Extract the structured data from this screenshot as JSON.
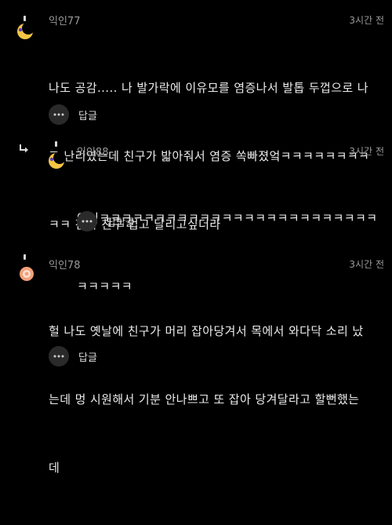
{
  "comments": [
    {
      "nickname": "익인77",
      "time": "3시간 전",
      "lines": [
        "나도 공감..... 나 발가락에 이유모를 염증나서 발톱 두껍으로 나",
        "고 난리였는데 친구가 밟아줘서 염증 쏙빠졌엌ㅋㅋㅋㅋㅋㅋㅋㅋ",
        "ㅋㅋ 진짜 친구 업고 달리고싶더라"
      ],
      "action_label": "답글",
      "avatar_icon": "moon-avatar-icon"
    },
    {
      "nickname": "익인88",
      "time": "3시간 전",
      "lines": [
        "아닠ㅋㅋㅋㅋㅋㅋㅋㅋㅋㅋㅋㅋㅋㅋㅋㅋㅋㅋㅋㅋㅋㅋㅋㅋㅋ",
        "ㅋㅋㅋㅋㅋ"
      ],
      "action_label": "답답글",
      "avatar_icon": "moon-avatar-icon",
      "is_reply": true
    },
    {
      "nickname": "익인78",
      "time": "3시간 전",
      "lines": [
        "헐 나도 옛날에 친구가 머리 잡아당겨서 목에서 와다닥 소리 났",
        "는데 멍 시원해서 기분 안나쁘고 또 잡아 당겨달라고 할뻔했는",
        "데"
      ],
      "action_label": "답글",
      "avatar_icon": "flower-avatar-icon"
    }
  ],
  "colors": {
    "background": "#000000",
    "meta_text": "#9a9a9a",
    "body_text": "#ececec",
    "button_bg": "#2a2a2a",
    "moon_yellow": "#f6c544",
    "moon_purple": "#5a3fbf",
    "flower_peach": "#f4a07a"
  }
}
